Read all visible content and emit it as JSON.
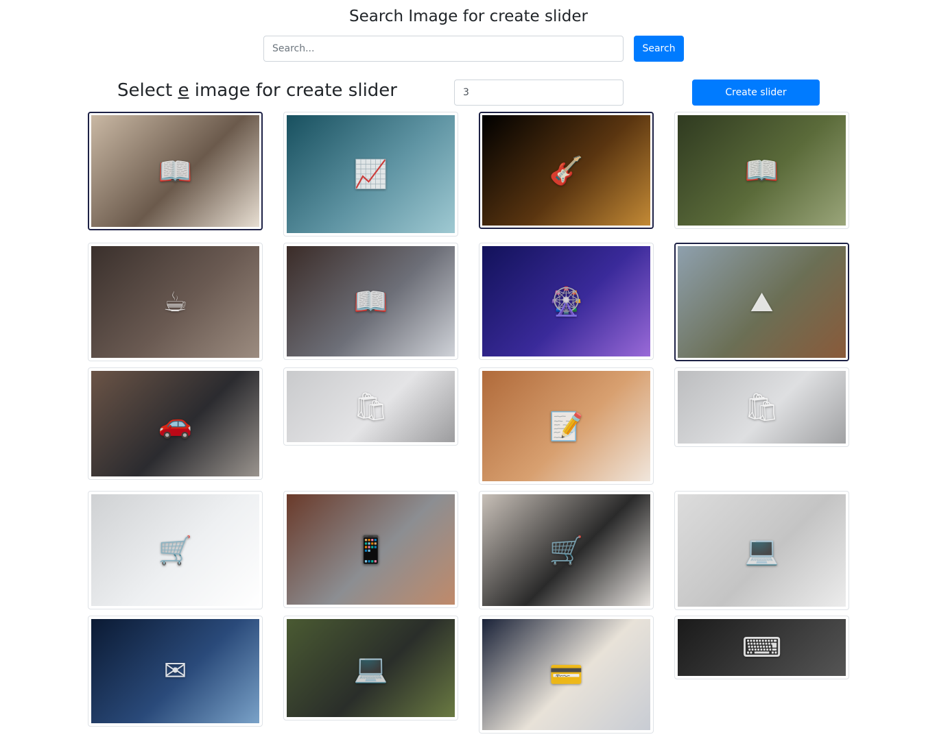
{
  "header": {
    "title": "Search Image for create slider"
  },
  "search": {
    "placeholder": "Search...",
    "button_label": "Search"
  },
  "controls": {
    "subtitle_prefix": "Select ",
    "subtitle_underlined": "e",
    "subtitle_suffix": " image for create slider",
    "count_value": "3",
    "create_button_label": "Create slider"
  },
  "gallery": [
    {
      "name": "photo-tablet-reading",
      "selected": true,
      "colors": [
        "#c9b8a4",
        "#6b5a4c",
        "#e7ded2"
      ],
      "icon": "📖"
    },
    {
      "name": "photo-stock-chart",
      "selected": false,
      "colors": [
        "#18505f",
        "#5f94a3",
        "#9fc9d2"
      ],
      "icon": "📈"
    },
    {
      "name": "photo-guitar",
      "selected": true,
      "colors": [
        "#000000",
        "#5a3510",
        "#c38a36"
      ],
      "icon": "🎸"
    },
    {
      "name": "photo-ereader-grass",
      "selected": false,
      "colors": [
        "#2f3a20",
        "#5b6b3a",
        "#9aa57a"
      ],
      "icon": "📖"
    },
    {
      "name": "photo-ereader-coffee",
      "selected": false,
      "colors": [
        "#3a302c",
        "#6a5a52",
        "#9c8c80"
      ],
      "icon": "☕"
    },
    {
      "name": "photo-ereader-hand",
      "selected": false,
      "colors": [
        "#3b2c28",
        "#6d6f78",
        "#cfd2d8"
      ],
      "icon": "📖"
    },
    {
      "name": "photo-ferris-wheel",
      "selected": false,
      "colors": [
        "#12125a",
        "#3a2a9a",
        "#9a6ad8"
      ],
      "icon": "🎡"
    },
    {
      "name": "photo-mountains",
      "selected": true,
      "colors": [
        "#8ea0ae",
        "#6b6f55",
        "#8a5a3a"
      ],
      "icon": "⛰"
    },
    {
      "name": "photo-classic-car",
      "selected": false,
      "colors": [
        "#6b5446",
        "#2b2b2f",
        "#9a948e"
      ],
      "icon": "🚗"
    },
    {
      "name": "photo-online-payment",
      "selected": false,
      "colors": [
        "#c9cacc",
        "#e4e4e6",
        "#9c9c9e"
      ],
      "icon": "🛍"
    },
    {
      "name": "photo-desk-notebook",
      "selected": false,
      "colors": [
        "#b06a3a",
        "#d8a070",
        "#f0e6dc"
      ],
      "icon": "📝"
    },
    {
      "name": "photo-laptop-shopping",
      "selected": false,
      "colors": [
        "#bcbdbf",
        "#dedfe1",
        "#a0a1a3"
      ],
      "icon": "🛍"
    },
    {
      "name": "photo-keyboard-cart",
      "selected": false,
      "colors": [
        "#cfd1d3",
        "#eef0f2",
        "#ffffff"
      ],
      "icon": "🛒"
    },
    {
      "name": "photo-laptop-phone",
      "selected": false,
      "colors": [
        "#6a3a2a",
        "#8c8e92",
        "#c08a6a"
      ],
      "icon": "📱"
    },
    {
      "name": "photo-tablet-shopping",
      "selected": false,
      "colors": [
        "#c8c0b8",
        "#2a2a2a",
        "#e8e4e0"
      ],
      "icon": "🛒"
    },
    {
      "name": "photo-laptop-glasses",
      "selected": false,
      "colors": [
        "#dcdcdc",
        "#c4c4c4",
        "#ececec"
      ],
      "icon": "💻"
    },
    {
      "name": "photo-email-hand",
      "selected": false,
      "colors": [
        "#0b1a33",
        "#2a4a7a",
        "#7aa2c8"
      ],
      "icon": "✉"
    },
    {
      "name": "photo-devices-desk",
      "selected": false,
      "colors": [
        "#4a5a32",
        "#2a2e2a",
        "#6a7a42"
      ],
      "icon": "💻"
    },
    {
      "name": "photo-phone-card",
      "selected": false,
      "colors": [
        "#1a2238",
        "#e8e2d8",
        "#c8ccd4"
      ],
      "icon": "💳"
    },
    {
      "name": "photo-black-keyboard",
      "selected": false,
      "colors": [
        "#1a1a1a",
        "#3a3a3a",
        "#555555"
      ],
      "icon": "⌨"
    }
  ]
}
